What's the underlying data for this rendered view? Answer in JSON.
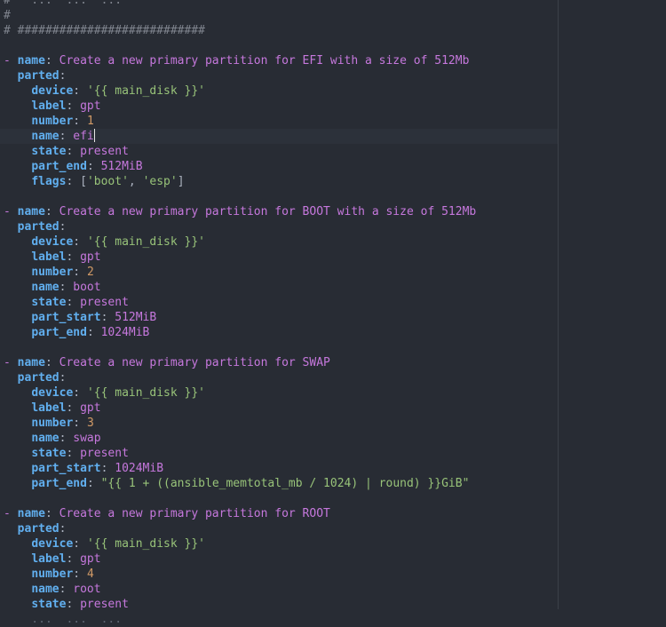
{
  "editor": {
    "colors": {
      "background": "#282c34",
      "comment": "#7f848e",
      "key": "#61afef",
      "string": "#c678dd",
      "number": "#d19a66",
      "quoted": "#98c379"
    },
    "cursor_line": 9,
    "lines": [
      [
        {
          "t": "comment",
          "v": "#   ...  ...  ..."
        }
      ],
      [
        {
          "t": "comment",
          "v": "#"
        }
      ],
      [
        {
          "t": "comment",
          "v": "# ###########################"
        }
      ],
      [],
      [
        {
          "t": "dash",
          "v": "- "
        },
        {
          "t": "key",
          "v": "name"
        },
        {
          "t": "punct",
          "v": ": "
        },
        {
          "t": "str",
          "v": "Create a new primary partition for EFI with a size of 512Mb"
        }
      ],
      [
        {
          "t": "punct",
          "v": "  "
        },
        {
          "t": "key",
          "v": "parted"
        },
        {
          "t": "punct",
          "v": ":"
        }
      ],
      [
        {
          "t": "punct",
          "v": "    "
        },
        {
          "t": "key",
          "v": "device"
        },
        {
          "t": "punct",
          "v": ": "
        },
        {
          "t": "quoted",
          "v": "'{{ main_disk }}'"
        }
      ],
      [
        {
          "t": "punct",
          "v": "    "
        },
        {
          "t": "key",
          "v": "label"
        },
        {
          "t": "punct",
          "v": ": "
        },
        {
          "t": "str",
          "v": "gpt"
        }
      ],
      [
        {
          "t": "punct",
          "v": "    "
        },
        {
          "t": "key",
          "v": "number"
        },
        {
          "t": "punct",
          "v": ": "
        },
        {
          "t": "num",
          "v": "1"
        }
      ],
      [
        {
          "t": "punct",
          "v": "    "
        },
        {
          "t": "key",
          "v": "name"
        },
        {
          "t": "punct",
          "v": ": "
        },
        {
          "t": "str",
          "v": "efi"
        },
        {
          "t": "caret",
          "v": ""
        }
      ],
      [
        {
          "t": "punct",
          "v": "    "
        },
        {
          "t": "key",
          "v": "state"
        },
        {
          "t": "punct",
          "v": ": "
        },
        {
          "t": "str",
          "v": "present"
        }
      ],
      [
        {
          "t": "punct",
          "v": "    "
        },
        {
          "t": "key",
          "v": "part_end"
        },
        {
          "t": "punct",
          "v": ": "
        },
        {
          "t": "str",
          "v": "512MiB"
        }
      ],
      [
        {
          "t": "punct",
          "v": "    "
        },
        {
          "t": "key",
          "v": "flags"
        },
        {
          "t": "punct",
          "v": ": ["
        },
        {
          "t": "quoted",
          "v": "'boot'"
        },
        {
          "t": "punct",
          "v": ", "
        },
        {
          "t": "quoted",
          "v": "'esp'"
        },
        {
          "t": "punct",
          "v": "]"
        }
      ],
      [],
      [
        {
          "t": "dash",
          "v": "- "
        },
        {
          "t": "key",
          "v": "name"
        },
        {
          "t": "punct",
          "v": ": "
        },
        {
          "t": "str",
          "v": "Create a new primary partition for BOOT with a size of 512Mb"
        }
      ],
      [
        {
          "t": "punct",
          "v": "  "
        },
        {
          "t": "key",
          "v": "parted"
        },
        {
          "t": "punct",
          "v": ":"
        }
      ],
      [
        {
          "t": "punct",
          "v": "    "
        },
        {
          "t": "key",
          "v": "device"
        },
        {
          "t": "punct",
          "v": ": "
        },
        {
          "t": "quoted",
          "v": "'{{ main_disk }}'"
        }
      ],
      [
        {
          "t": "punct",
          "v": "    "
        },
        {
          "t": "key",
          "v": "label"
        },
        {
          "t": "punct",
          "v": ": "
        },
        {
          "t": "str",
          "v": "gpt"
        }
      ],
      [
        {
          "t": "punct",
          "v": "    "
        },
        {
          "t": "key",
          "v": "number"
        },
        {
          "t": "punct",
          "v": ": "
        },
        {
          "t": "num",
          "v": "2"
        }
      ],
      [
        {
          "t": "punct",
          "v": "    "
        },
        {
          "t": "key",
          "v": "name"
        },
        {
          "t": "punct",
          "v": ": "
        },
        {
          "t": "str",
          "v": "boot"
        }
      ],
      [
        {
          "t": "punct",
          "v": "    "
        },
        {
          "t": "key",
          "v": "state"
        },
        {
          "t": "punct",
          "v": ": "
        },
        {
          "t": "str",
          "v": "present"
        }
      ],
      [
        {
          "t": "punct",
          "v": "    "
        },
        {
          "t": "key",
          "v": "part_start"
        },
        {
          "t": "punct",
          "v": ": "
        },
        {
          "t": "str",
          "v": "512MiB"
        }
      ],
      [
        {
          "t": "punct",
          "v": "    "
        },
        {
          "t": "key",
          "v": "part_end"
        },
        {
          "t": "punct",
          "v": ": "
        },
        {
          "t": "str",
          "v": "1024MiB"
        }
      ],
      [],
      [
        {
          "t": "dash",
          "v": "- "
        },
        {
          "t": "key",
          "v": "name"
        },
        {
          "t": "punct",
          "v": ": "
        },
        {
          "t": "str",
          "v": "Create a new primary partition for SWAP"
        }
      ],
      [
        {
          "t": "punct",
          "v": "  "
        },
        {
          "t": "key",
          "v": "parted"
        },
        {
          "t": "punct",
          "v": ":"
        }
      ],
      [
        {
          "t": "punct",
          "v": "    "
        },
        {
          "t": "key",
          "v": "device"
        },
        {
          "t": "punct",
          "v": ": "
        },
        {
          "t": "quoted",
          "v": "'{{ main_disk }}'"
        }
      ],
      [
        {
          "t": "punct",
          "v": "    "
        },
        {
          "t": "key",
          "v": "label"
        },
        {
          "t": "punct",
          "v": ": "
        },
        {
          "t": "str",
          "v": "gpt"
        }
      ],
      [
        {
          "t": "punct",
          "v": "    "
        },
        {
          "t": "key",
          "v": "number"
        },
        {
          "t": "punct",
          "v": ": "
        },
        {
          "t": "num",
          "v": "3"
        }
      ],
      [
        {
          "t": "punct",
          "v": "    "
        },
        {
          "t": "key",
          "v": "name"
        },
        {
          "t": "punct",
          "v": ": "
        },
        {
          "t": "str",
          "v": "swap"
        }
      ],
      [
        {
          "t": "punct",
          "v": "    "
        },
        {
          "t": "key",
          "v": "state"
        },
        {
          "t": "punct",
          "v": ": "
        },
        {
          "t": "str",
          "v": "present"
        }
      ],
      [
        {
          "t": "punct",
          "v": "    "
        },
        {
          "t": "key",
          "v": "part_start"
        },
        {
          "t": "punct",
          "v": ": "
        },
        {
          "t": "str",
          "v": "1024MiB"
        }
      ],
      [
        {
          "t": "punct",
          "v": "    "
        },
        {
          "t": "key",
          "v": "part_end"
        },
        {
          "t": "punct",
          "v": ": "
        },
        {
          "t": "quoted",
          "v": "\"{{ 1 + ((ansible_memtotal_mb / 1024) | round) }}GiB\""
        }
      ],
      [],
      [
        {
          "t": "dash",
          "v": "- "
        },
        {
          "t": "key",
          "v": "name"
        },
        {
          "t": "punct",
          "v": ": "
        },
        {
          "t": "str",
          "v": "Create a new primary partition for ROOT"
        }
      ],
      [
        {
          "t": "punct",
          "v": "  "
        },
        {
          "t": "key",
          "v": "parted"
        },
        {
          "t": "punct",
          "v": ":"
        }
      ],
      [
        {
          "t": "punct",
          "v": "    "
        },
        {
          "t": "key",
          "v": "device"
        },
        {
          "t": "punct",
          "v": ": "
        },
        {
          "t": "quoted",
          "v": "'{{ main_disk }}'"
        }
      ],
      [
        {
          "t": "punct",
          "v": "    "
        },
        {
          "t": "key",
          "v": "label"
        },
        {
          "t": "punct",
          "v": ": "
        },
        {
          "t": "str",
          "v": "gpt"
        }
      ],
      [
        {
          "t": "punct",
          "v": "    "
        },
        {
          "t": "key",
          "v": "number"
        },
        {
          "t": "punct",
          "v": ": "
        },
        {
          "t": "num",
          "v": "4"
        }
      ],
      [
        {
          "t": "punct",
          "v": "    "
        },
        {
          "t": "key",
          "v": "name"
        },
        {
          "t": "punct",
          "v": ": "
        },
        {
          "t": "str",
          "v": "root"
        }
      ],
      [
        {
          "t": "punct",
          "v": "    "
        },
        {
          "t": "key",
          "v": "state"
        },
        {
          "t": "punct",
          "v": ": "
        },
        {
          "t": "str",
          "v": "present"
        }
      ],
      [
        {
          "t": "partial",
          "v": "    ...  ...  ..."
        }
      ]
    ]
  }
}
